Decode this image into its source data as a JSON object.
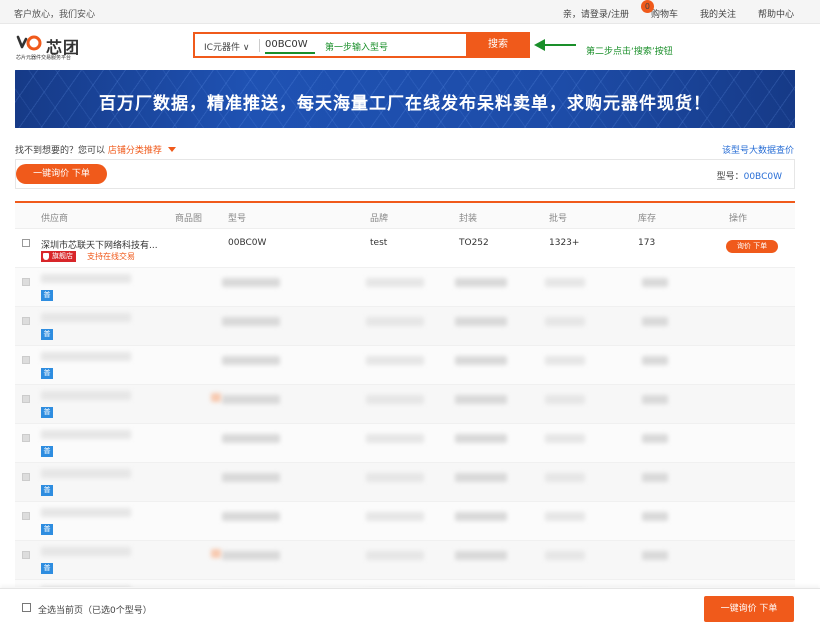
{
  "topbar": {
    "slogan": "客户放心，我们安心",
    "login": "亲，请登录/注册",
    "cart_count": "0",
    "cart": "购物车",
    "follow": "我的关注",
    "help": "帮助中心"
  },
  "logo": {
    "name": "芯团",
    "tagline": "芯片元器件交易服务平台"
  },
  "search": {
    "category": "IC元器件",
    "query": "00BC0W",
    "step1_hint": "第一步输入型号",
    "button": "搜索",
    "step2_hint": "第二步点击‘搜索’按钮"
  },
  "banner": {
    "text": "百万厂数据，精准推送，每天海量工厂在线发布呆料卖单，求购元器件现货！"
  },
  "helper": {
    "prompt": "找不到想要的？您可以",
    "link": "店铺分类推荐",
    "bigdata": "该型号大数据查价"
  },
  "query_bar": {
    "button": "一键询价 下单",
    "model_label": "型号：",
    "model_value": "00BC0W"
  },
  "table": {
    "headers": [
      "供应商",
      "商品图",
      "型号",
      "品牌",
      "封装",
      "批号",
      "库存",
      "操作"
    ],
    "first_row": {
      "supplier": "深圳市芯联天下网络科技有...",
      "flag": "旗舰店",
      "online": "支持在线交易",
      "model": "00BC0W",
      "brand": "test",
      "package": "TO252",
      "lot": "1323+",
      "stock": "173",
      "action": "询价 下单"
    },
    "badge": "普"
  },
  "footer": {
    "select_all": "全选当前页（已选0个型号）",
    "button": "一键询价 下单"
  },
  "colors": {
    "accent": "#f05a1b",
    "hint_green": "#1a8f2a",
    "link_blue": "#2a6fd6",
    "badge_blue": "#2e8de0"
  }
}
